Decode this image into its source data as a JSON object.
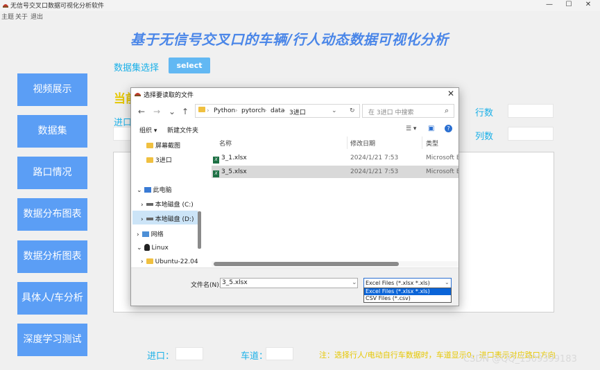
{
  "window": {
    "title": "无信号交叉口数据可视化分析软件",
    "controls": [
      "—",
      "☐",
      "✕"
    ],
    "menu": [
      "主题",
      "关于",
      "退出"
    ]
  },
  "main": {
    "title": "基于无信号交叉口的车辆/行人动态数据可视化分析",
    "dataset_label": "数据集选择",
    "select_button": "select",
    "current_label": "当前",
    "entry_label": "进口",
    "rows_label": "行数",
    "cols_label": "列数"
  },
  "sidebar": {
    "buttons": [
      "视频展示",
      "数据集",
      "路口情况",
      "数据分布图表",
      "数据分析图表",
      "具体人/车分析",
      "深度学习测试"
    ]
  },
  "bottom": {
    "entry_label": "进口：",
    "lane_label": "车道：",
    "note": "注：选择行人/电动自行车数据时，车道显示0，进口表示对应路口方向",
    "watermark": "CSDN @QQ_1309399183"
  },
  "dialog": {
    "title": "选择要读取的文件",
    "close": "✕",
    "nav": [
      "←",
      "→",
      "⌄",
      "↑"
    ],
    "breadcrumb": [
      "Python",
      "pytorch",
      "data",
      "3进口"
    ],
    "breadcrumb_sep": "›",
    "refresh_icon": "↻",
    "dropdown_icon": "⌄",
    "search_placeholder": "在 3进口 中搜索",
    "search_icon": "⌕",
    "organize": "组织 ▾",
    "new_folder": "新建文件夹",
    "view_icon": "☰ ▾",
    "pane_icon": "▣",
    "help_icon": "?",
    "nav_items": [
      {
        "label": "屏幕截图",
        "icon": "folder"
      },
      {
        "label": "3进口",
        "icon": "folder"
      },
      {
        "label": "此电脑",
        "icon": "pc",
        "expander": "⌄"
      },
      {
        "label": "本地磁盘 (C:)",
        "icon": "drive",
        "expander": "›"
      },
      {
        "label": "本地磁盘 (D:)",
        "icon": "drive",
        "expander": "›"
      },
      {
        "label": "网络",
        "icon": "net",
        "expander": "›"
      },
      {
        "label": "Linux",
        "icon": "tux",
        "expander": "⌄"
      },
      {
        "label": "Ubuntu-22.04",
        "icon": "folder",
        "expander": "›"
      }
    ],
    "columns": {
      "name": "名称",
      "modified": "修改日期",
      "type": "类型"
    },
    "files": [
      {
        "name": "3_1.xlsx",
        "modified": "2024/1/21 7:53",
        "type": "Microsoft Ex",
        "selected": false
      },
      {
        "name": "3_5.xlsx",
        "modified": "2024/1/21 7:53",
        "type": "Microsoft Ex",
        "selected": true
      }
    ],
    "filename_label": "文件名(N):",
    "filename_value": "3_5.xlsx",
    "filetype_selected": "Excel Files (*.xlsx *.xls)",
    "filetype_options": [
      "Excel Files (*.xlsx *.xls)",
      "CSV Files (*.csv)"
    ]
  },
  "colors": {
    "title_blue": "#4a86e8",
    "label_cyan": "#1ab0e8",
    "button_blue": "#5b9ef5",
    "note_yellow": "#e6c700"
  }
}
